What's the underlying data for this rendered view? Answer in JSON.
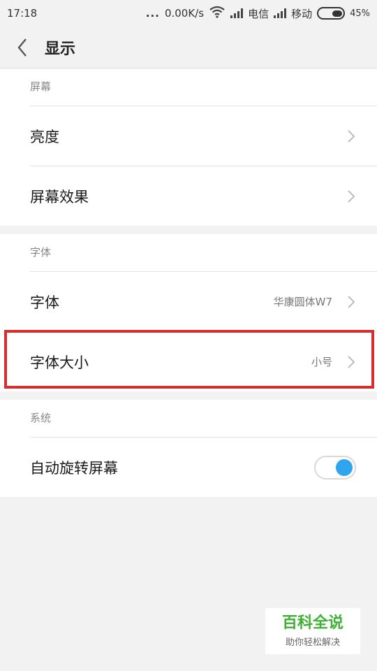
{
  "status_bar": {
    "time": "17:18",
    "dots": "...",
    "speed": "0.00K/s",
    "carrier1": "电信",
    "carrier2": "移动",
    "battery": "45%"
  },
  "header": {
    "title": "显示",
    "back_icon": "chevron-left-icon"
  },
  "sections": {
    "screen": {
      "label": "屏幕",
      "items": [
        {
          "label": "亮度"
        },
        {
          "label": "屏幕效果"
        }
      ]
    },
    "font": {
      "label": "字体",
      "items": [
        {
          "label": "字体",
          "value": "华康圆体W7"
        },
        {
          "label": "字体大小",
          "value": "小号"
        }
      ]
    },
    "system": {
      "label": "系统",
      "items": [
        {
          "label": "自动旋转屏幕",
          "toggle": "on"
        }
      ]
    }
  },
  "watermark": {
    "title": "百科全说",
    "subtitle": "助你轻松解决"
  },
  "colors": {
    "highlight": "#d32f2f",
    "toggle_on": "#2fa5f0",
    "watermark": "#3eb135"
  }
}
